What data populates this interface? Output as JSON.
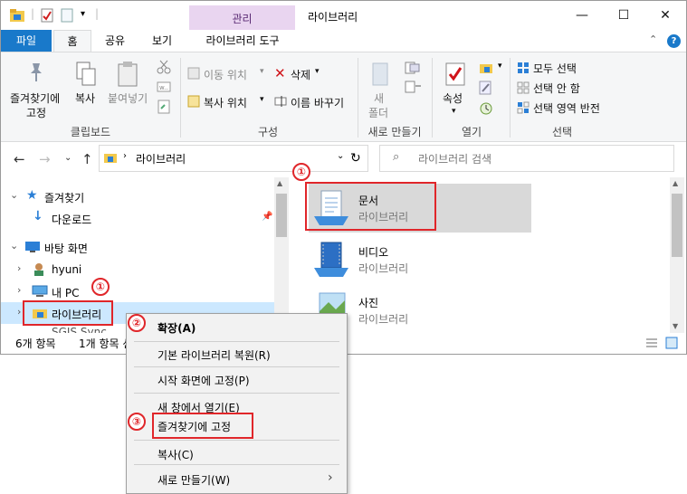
{
  "titlebar": {
    "context_tab_header": "관리",
    "title": "라이브러리",
    "minimize": "—",
    "maximize": "☐",
    "close": "✕"
  },
  "tabs": {
    "file": "파일",
    "home": "홈",
    "share": "공유",
    "view": "보기",
    "library_tools": "라이브러리 도구"
  },
  "ribbon": {
    "pin_label_1": "즐겨찾기에",
    "pin_label_2": "고정",
    "copy": "복사",
    "paste": "붙여넣기",
    "clipboard_group": "클립보드",
    "move_to": "이동 위치",
    "copy_to": "복사 위치",
    "delete": "삭제",
    "rename": "이름 바꾸기",
    "organize_group": "구성",
    "new_folder_1": "새",
    "new_folder_2": "폴더",
    "new_group": "새로 만들기",
    "properties": "속성",
    "open_group": "열기",
    "select_all": "모두 선택",
    "select_none": "선택 안 함",
    "invert_selection": "선택 영역 반전",
    "select_group": "선택"
  },
  "address": {
    "path": "라이브러리",
    "search_placeholder": "라이브러리 검색"
  },
  "nav": {
    "favorites": "즐겨찾기",
    "downloads": "다운로드",
    "desktop": "바탕 화면",
    "user": "hyuni",
    "this_pc": "내 PC",
    "libraries": "라이브러리",
    "partial_item": "SGIS Sync..."
  },
  "content": {
    "items": [
      {
        "name": "문서",
        "type": "라이브러리"
      },
      {
        "name": "비디오",
        "type": "라이브러리"
      },
      {
        "name": "사진",
        "type": "라이브러리"
      }
    ]
  },
  "status": {
    "count": "6개 항목",
    "selected": "1개 항목 선"
  },
  "context_menu": {
    "expand": "확장(A)",
    "restore_default": "기본 라이브러리 복원(R)",
    "pin_start": "시작 화면에 고정(P)",
    "open_new_window": "새 창에서 열기(E)",
    "pin_quick_access": "즐겨찾기에 고정",
    "copy": "복사(C)",
    "new": "새로 만들기(W)"
  },
  "markers": {
    "one": "①",
    "two": "②",
    "three": "③"
  },
  "colors": {
    "accent": "#1979ca",
    "selection": "#cce8ff",
    "highlight_item": "#d9d9d9",
    "marker_red": "#e0262a",
    "context_tab": "#e9d5f0"
  }
}
